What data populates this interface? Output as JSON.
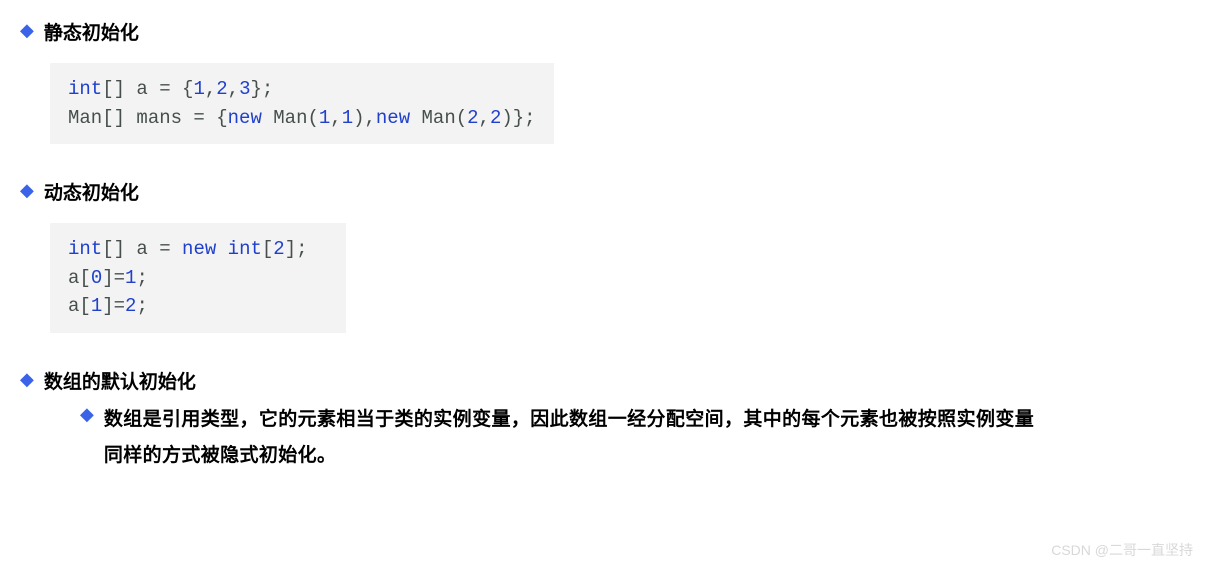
{
  "sections": [
    {
      "heading": "静态初始化"
    },
    {
      "heading": "动态初始化"
    },
    {
      "heading": "数组的默认初始化"
    }
  ],
  "code1": {
    "l1p1": "int",
    "l1p2": "[] a = {",
    "l1p3": "1",
    "l1p4": ",",
    "l1p5": "2",
    "l1p6": ",",
    "l1p7": "3",
    "l1p8": "};",
    "l2p1": "Man[] mans = {",
    "l2p2": "new",
    "l2p3": " Man(",
    "l2p4": "1",
    "l2p5": ",",
    "l2p6": "1",
    "l2p7": "),",
    "l2p8": "new",
    "l2p9": " Man(",
    "l2p10": "2",
    "l2p11": ",",
    "l2p12": "2",
    "l2p13": ")};"
  },
  "code2": {
    "l1p1": "int",
    "l1p2": "[] a = ",
    "l1p3": "new",
    "l1p4": " ",
    "l1p5": "int",
    "l1p6": "[",
    "l1p7": "2",
    "l1p8": "];",
    "l2p1": "a[",
    "l2p2": "0",
    "l2p3": "]=",
    "l2p4": "1",
    "l2p5": ";",
    "l3p1": "a[",
    "l3p2": "1",
    "l3p3": "]=",
    "l3p4": "2",
    "l3p5": ";"
  },
  "sub": {
    "text": "数组是引用类型，它的元素相当于类的实例变量，因此数组一经分配空间，其中的每个元素也被按照实例变量同样的方式被隐式初始化。"
  },
  "watermark": "CSDN @二哥一直坚持"
}
